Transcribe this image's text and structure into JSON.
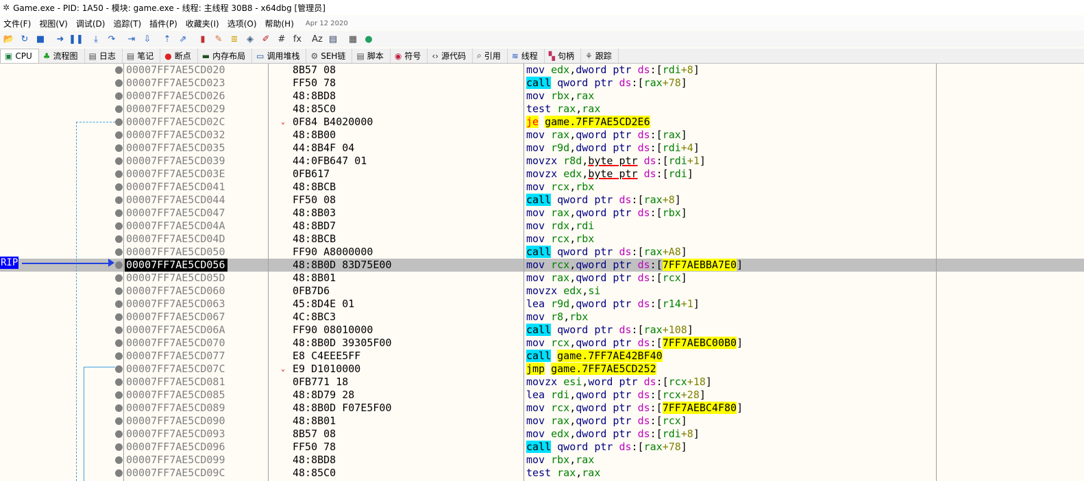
{
  "window": {
    "title": "Game.exe - PID: 1A50 - 模块: game.exe - 线程: 主线程 30B8 - x64dbg [管理员]"
  },
  "menu": [
    "文件(F)",
    "视图(V)",
    "调试(D)",
    "追踪(T)",
    "插件(P)",
    "收藏夹(I)",
    "选项(O)",
    "帮助(H)"
  ],
  "build_date": "Apr 12 2020",
  "toolbar_icons": [
    {
      "name": "open-icon",
      "glyph": "📂",
      "color": "#d8a030"
    },
    {
      "name": "restart-icon",
      "glyph": "↻",
      "color": "#2060c0"
    },
    {
      "name": "stop-icon",
      "glyph": "■",
      "color": "#2060c0"
    },
    {
      "name": "sep"
    },
    {
      "name": "run-icon",
      "glyph": "➜",
      "color": "#2060c0"
    },
    {
      "name": "pause-icon",
      "glyph": "❚❚",
      "color": "#2060c0"
    },
    {
      "name": "sep"
    },
    {
      "name": "step-into-icon",
      "glyph": "⤓",
      "color": "#2060c0"
    },
    {
      "name": "step-over-icon",
      "glyph": "↷",
      "color": "#2060c0"
    },
    {
      "name": "sep"
    },
    {
      "name": "trace-into-icon",
      "glyph": "⇥",
      "color": "#2060c0"
    },
    {
      "name": "trace-over-icon",
      "glyph": "⇩",
      "color": "#2060c0"
    },
    {
      "name": "sep"
    },
    {
      "name": "execute-till-return-icon",
      "glyph": "⇡",
      "color": "#2060c0"
    },
    {
      "name": "run-to-user-code-icon",
      "glyph": "⇗",
      "color": "#2060c0"
    },
    {
      "name": "sep"
    },
    {
      "name": "scylla-icon",
      "glyph": "▮",
      "color": "#c03030"
    },
    {
      "name": "patch-icon",
      "glyph": "✎",
      "color": "#d07030"
    },
    {
      "name": "comment-icon",
      "glyph": "≣",
      "color": "#d0a000"
    },
    {
      "name": "label-icon",
      "glyph": "◈",
      "color": "#406080"
    },
    {
      "name": "highlight-icon",
      "glyph": "✐",
      "color": "#c02020"
    },
    {
      "name": "hash-icon",
      "glyph": "#",
      "color": "#303030"
    },
    {
      "name": "function-icon",
      "glyph": "fx",
      "color": "#303030"
    },
    {
      "name": "sep"
    },
    {
      "name": "font-icon",
      "glyph": "Aᴢ",
      "color": "#303030"
    },
    {
      "name": "document-icon",
      "glyph": "▤",
      "color": "#304060"
    },
    {
      "name": "sep"
    },
    {
      "name": "calculator-icon",
      "glyph": "▦",
      "color": "#404040"
    },
    {
      "name": "globe-icon",
      "glyph": "●",
      "color": "#20a060"
    }
  ],
  "tabs": [
    {
      "label": "CPU",
      "icon": "cpu-icon",
      "glyph": "▣",
      "color": "#208040"
    },
    {
      "label": "流程图",
      "icon": "graph-icon",
      "glyph": "♣",
      "color": "#20a020"
    },
    {
      "label": "日志",
      "icon": "log-icon",
      "glyph": "▤",
      "color": "#505050"
    },
    {
      "label": "笔记",
      "icon": "notes-icon",
      "glyph": "▤",
      "color": "#505050"
    },
    {
      "label": "断点",
      "icon": "breakpoint-icon",
      "glyph": "●",
      "color": "#e02020"
    },
    {
      "label": "内存布局",
      "icon": "memory-map-icon",
      "glyph": "▬",
      "color": "#205020"
    },
    {
      "label": "调用堆栈",
      "icon": "call-stack-icon",
      "glyph": "▭",
      "color": "#2050a0"
    },
    {
      "label": "SEH链",
      "icon": "seh-icon",
      "glyph": "⚙",
      "color": "#505050"
    },
    {
      "label": "脚本",
      "icon": "script-icon",
      "glyph": "▤",
      "color": "#505050"
    },
    {
      "label": "符号",
      "icon": "symbols-icon",
      "glyph": "◉",
      "color": "#c02040"
    },
    {
      "label": "源代码",
      "icon": "source-icon",
      "glyph": "‹›",
      "color": "#303030"
    },
    {
      "label": "引用",
      "icon": "references-icon",
      "glyph": "⌕",
      "color": "#303030"
    },
    {
      "label": "线程",
      "icon": "threads-icon",
      "glyph": "≋",
      "color": "#2050c0"
    },
    {
      "label": "句柄",
      "icon": "handles-icon",
      "glyph": "▚",
      "color": "#c03060"
    },
    {
      "label": "跟踪",
      "icon": "trace-icon",
      "glyph": "⚘",
      "color": "#505050"
    }
  ],
  "rip_label": "RIP",
  "rows": [
    {
      "addr": "00007FF7AE5CD020",
      "bytes": "8B57 08",
      "tokens": [
        [
          "mn",
          "mov "
        ],
        [
          "reg",
          "edx"
        ],
        [
          "pl",
          ","
        ],
        [
          "kw",
          "dword ptr "
        ],
        [
          "seg",
          "ds"
        ],
        [
          "pl",
          ":["
        ],
        [
          "reg",
          "rdi"
        ],
        [
          "num",
          "+8"
        ],
        [
          "pl",
          "]"
        ]
      ]
    },
    {
      "addr": "00007FF7AE5CD023",
      "bytes": "FF50 78",
      "tokens": [
        [
          "call",
          "call"
        ],
        [
          "pl",
          " "
        ],
        [
          "kw",
          "qword ptr "
        ],
        [
          "seg",
          "ds"
        ],
        [
          "pl",
          ":["
        ],
        [
          "reg",
          "rax"
        ],
        [
          "num",
          "+78"
        ],
        [
          "pl",
          "]"
        ]
      ]
    },
    {
      "addr": "00007FF7AE5CD026",
      "bytes": "48:8BD8",
      "tokens": [
        [
          "mn",
          "mov "
        ],
        [
          "reg",
          "rbx"
        ],
        [
          "pl",
          ","
        ],
        [
          "reg",
          "rax"
        ]
      ]
    },
    {
      "addr": "00007FF7AE5CD029",
      "bytes": "48:85C0",
      "tokens": [
        [
          "mn",
          "test "
        ],
        [
          "reg",
          "rax"
        ],
        [
          "pl",
          ","
        ],
        [
          "reg",
          "rax"
        ]
      ]
    },
    {
      "addr": "00007FF7AE5CD02C",
      "bytes": "0F84 B4020000",
      "jump": "⌄",
      "tokens": [
        [
          "jcc",
          "je"
        ],
        [
          "pl",
          " "
        ],
        [
          "jmp",
          "game.7FF7AE5CD2E6"
        ]
      ]
    },
    {
      "addr": "00007FF7AE5CD032",
      "bytes": "48:8B00",
      "tokens": [
        [
          "mn",
          "mov "
        ],
        [
          "reg",
          "rax"
        ],
        [
          "pl",
          ","
        ],
        [
          "kw",
          "qword ptr "
        ],
        [
          "seg",
          "ds"
        ],
        [
          "pl",
          ":["
        ],
        [
          "reg",
          "rax"
        ],
        [
          "pl",
          "]"
        ]
      ]
    },
    {
      "addr": "00007FF7AE5CD035",
      "bytes": "44:8B4F 04",
      "tokens": [
        [
          "mn",
          "mov "
        ],
        [
          "reg",
          "r9d"
        ],
        [
          "pl",
          ","
        ],
        [
          "kw",
          "dword ptr "
        ],
        [
          "seg",
          "ds"
        ],
        [
          "pl",
          ":["
        ],
        [
          "reg",
          "rdi"
        ],
        [
          "num",
          "+4"
        ],
        [
          "pl",
          "]"
        ]
      ]
    },
    {
      "addr": "00007FF7AE5CD039",
      "bytes": "44:0FB647 01",
      "tokens": [
        [
          "mn",
          "movzx "
        ],
        [
          "reg",
          "r8d"
        ],
        [
          "pl",
          ","
        ],
        [
          "ul",
          "byte ptr"
        ],
        [
          "pl",
          " "
        ],
        [
          "seg",
          "ds"
        ],
        [
          "pl",
          ":["
        ],
        [
          "reg",
          "rdi"
        ],
        [
          "num",
          "+1"
        ],
        [
          "pl",
          "]"
        ]
      ]
    },
    {
      "addr": "00007FF7AE5CD03E",
      "bytes": "0FB617",
      "tokens": [
        [
          "mn",
          "movzx "
        ],
        [
          "reg",
          "edx"
        ],
        [
          "pl",
          ","
        ],
        [
          "ul",
          "byte ptr"
        ],
        [
          "pl",
          " "
        ],
        [
          "seg",
          "ds"
        ],
        [
          "pl",
          ":["
        ],
        [
          "reg",
          "rdi"
        ],
        [
          "pl",
          "]"
        ]
      ]
    },
    {
      "addr": "00007FF7AE5CD041",
      "bytes": "48:8BCB",
      "tokens": [
        [
          "mn",
          "mov "
        ],
        [
          "reg",
          "rcx"
        ],
        [
          "pl",
          ","
        ],
        [
          "reg",
          "rbx"
        ]
      ]
    },
    {
      "addr": "00007FF7AE5CD044",
      "bytes": "FF50 08",
      "tokens": [
        [
          "call",
          "call"
        ],
        [
          "pl",
          " "
        ],
        [
          "kw",
          "qword ptr "
        ],
        [
          "seg",
          "ds"
        ],
        [
          "pl",
          ":["
        ],
        [
          "reg",
          "rax"
        ],
        [
          "num",
          "+8"
        ],
        [
          "pl",
          "]"
        ]
      ]
    },
    {
      "addr": "00007FF7AE5CD047",
      "bytes": "48:8B03",
      "tokens": [
        [
          "mn",
          "mov "
        ],
        [
          "reg",
          "rax"
        ],
        [
          "pl",
          ","
        ],
        [
          "kw",
          "qword ptr "
        ],
        [
          "seg",
          "ds"
        ],
        [
          "pl",
          ":["
        ],
        [
          "reg",
          "rbx"
        ],
        [
          "pl",
          "]"
        ]
      ]
    },
    {
      "addr": "00007FF7AE5CD04A",
      "bytes": "48:8BD7",
      "tokens": [
        [
          "mn",
          "mov "
        ],
        [
          "reg",
          "rdx"
        ],
        [
          "pl",
          ","
        ],
        [
          "reg",
          "rdi"
        ]
      ]
    },
    {
      "addr": "00007FF7AE5CD04D",
      "bytes": "48:8BCB",
      "tokens": [
        [
          "mn",
          "mov "
        ],
        [
          "reg",
          "rcx"
        ],
        [
          "pl",
          ","
        ],
        [
          "reg",
          "rbx"
        ]
      ]
    },
    {
      "addr": "00007FF7AE5CD050",
      "bytes": "FF90 A8000000",
      "tokens": [
        [
          "call",
          "call"
        ],
        [
          "pl",
          " "
        ],
        [
          "kw",
          "qword ptr "
        ],
        [
          "seg",
          "ds"
        ],
        [
          "pl",
          ":["
        ],
        [
          "reg",
          "rax"
        ],
        [
          "num",
          "+A8"
        ],
        [
          "pl",
          "]"
        ]
      ]
    },
    {
      "addr": "00007FF7AE5CD056",
      "bytes": "48:8B0D 83D75E00",
      "current": true,
      "tokens": [
        [
          "mn",
          "mov "
        ],
        [
          "reg",
          "rcx"
        ],
        [
          "pl",
          ","
        ],
        [
          "kw",
          "qword ptr "
        ],
        [
          "seg",
          "ds"
        ],
        [
          "pl",
          ":["
        ],
        [
          "addrref",
          "7FF7AEBBA7E0"
        ],
        [
          "pl",
          "]"
        ]
      ]
    },
    {
      "addr": "00007FF7AE5CD05D",
      "bytes": "48:8B01",
      "tokens": [
        [
          "mn",
          "mov "
        ],
        [
          "reg",
          "rax"
        ],
        [
          "pl",
          ","
        ],
        [
          "kw",
          "qword ptr "
        ],
        [
          "seg",
          "ds"
        ],
        [
          "pl",
          ":["
        ],
        [
          "reg",
          "rcx"
        ],
        [
          "pl",
          "]"
        ]
      ]
    },
    {
      "addr": "00007FF7AE5CD060",
      "bytes": "0FB7D6",
      "tokens": [
        [
          "mn",
          "movzx "
        ],
        [
          "reg",
          "edx"
        ],
        [
          "pl",
          ","
        ],
        [
          "reg",
          "si"
        ]
      ]
    },
    {
      "addr": "00007FF7AE5CD063",
      "bytes": "45:8D4E 01",
      "tokens": [
        [
          "mn",
          "lea "
        ],
        [
          "reg",
          "r9d"
        ],
        [
          "pl",
          ","
        ],
        [
          "kw",
          "qword ptr "
        ],
        [
          "seg",
          "ds"
        ],
        [
          "pl",
          ":["
        ],
        [
          "reg",
          "r14"
        ],
        [
          "num",
          "+1"
        ],
        [
          "pl",
          "]"
        ]
      ]
    },
    {
      "addr": "00007FF7AE5CD067",
      "bytes": "4C:8BC3",
      "tokens": [
        [
          "mn",
          "mov "
        ],
        [
          "reg",
          "r8"
        ],
        [
          "pl",
          ","
        ],
        [
          "reg",
          "rbx"
        ]
      ]
    },
    {
      "addr": "00007FF7AE5CD06A",
      "bytes": "FF90 08010000",
      "tokens": [
        [
          "call",
          "call"
        ],
        [
          "pl",
          " "
        ],
        [
          "kw",
          "qword ptr "
        ],
        [
          "seg",
          "ds"
        ],
        [
          "pl",
          ":["
        ],
        [
          "reg",
          "rax"
        ],
        [
          "num",
          "+108"
        ],
        [
          "pl",
          "]"
        ]
      ]
    },
    {
      "addr": "00007FF7AE5CD070",
      "bytes": "48:8B0D 39305F00",
      "tokens": [
        [
          "mn",
          "mov "
        ],
        [
          "reg",
          "rcx"
        ],
        [
          "pl",
          ","
        ],
        [
          "kw",
          "qword ptr "
        ],
        [
          "seg",
          "ds"
        ],
        [
          "pl",
          ":["
        ],
        [
          "addrref",
          "7FF7AEBC00B0"
        ],
        [
          "pl",
          "]"
        ]
      ]
    },
    {
      "addr": "00007FF7AE5CD077",
      "bytes": "E8 C4EEE5FF",
      "tokens": [
        [
          "call",
          "call"
        ],
        [
          "pl",
          " "
        ],
        [
          "jmp",
          "game.7FF7AE42BF40"
        ]
      ]
    },
    {
      "addr": "00007FF7AE5CD07C",
      "bytes": "E9 D1010000",
      "jump": "⌄",
      "tokens": [
        [
          "jmp",
          "jmp"
        ],
        [
          "pl",
          " "
        ],
        [
          "jmp",
          "game.7FF7AE5CD252"
        ]
      ]
    },
    {
      "addr": "00007FF7AE5CD081",
      "bytes": "0FB771 18",
      "tokens": [
        [
          "mn",
          "movzx "
        ],
        [
          "reg",
          "esi"
        ],
        [
          "pl",
          ","
        ],
        [
          "kw",
          "word ptr "
        ],
        [
          "seg",
          "ds"
        ],
        [
          "pl",
          ":["
        ],
        [
          "reg",
          "rcx"
        ],
        [
          "num",
          "+18"
        ],
        [
          "pl",
          "]"
        ]
      ]
    },
    {
      "addr": "00007FF7AE5CD085",
      "bytes": "48:8D79 28",
      "tokens": [
        [
          "mn",
          "lea "
        ],
        [
          "reg",
          "rdi"
        ],
        [
          "pl",
          ","
        ],
        [
          "kw",
          "qword ptr "
        ],
        [
          "seg",
          "ds"
        ],
        [
          "pl",
          ":["
        ],
        [
          "reg",
          "rcx"
        ],
        [
          "num",
          "+28"
        ],
        [
          "pl",
          "]"
        ]
      ]
    },
    {
      "addr": "00007FF7AE5CD089",
      "bytes": "48:8B0D F07E5F00",
      "tokens": [
        [
          "mn",
          "mov "
        ],
        [
          "reg",
          "rcx"
        ],
        [
          "pl",
          ","
        ],
        [
          "kw",
          "qword ptr "
        ],
        [
          "seg",
          "ds"
        ],
        [
          "pl",
          ":["
        ],
        [
          "addrref",
          "7FF7AEBC4F80"
        ],
        [
          "pl",
          "]"
        ]
      ]
    },
    {
      "addr": "00007FF7AE5CD090",
      "bytes": "48:8B01",
      "tokens": [
        [
          "mn",
          "mov "
        ],
        [
          "reg",
          "rax"
        ],
        [
          "pl",
          ","
        ],
        [
          "kw",
          "qword ptr "
        ],
        [
          "seg",
          "ds"
        ],
        [
          "pl",
          ":["
        ],
        [
          "reg",
          "rcx"
        ],
        [
          "pl",
          "]"
        ]
      ]
    },
    {
      "addr": "00007FF7AE5CD093",
      "bytes": "8B57 08",
      "tokens": [
        [
          "mn",
          "mov "
        ],
        [
          "reg",
          "edx"
        ],
        [
          "pl",
          ","
        ],
        [
          "kw",
          "dword ptr "
        ],
        [
          "seg",
          "ds"
        ],
        [
          "pl",
          ":["
        ],
        [
          "reg",
          "rdi"
        ],
        [
          "num",
          "+8"
        ],
        [
          "pl",
          "]"
        ]
      ]
    },
    {
      "addr": "00007FF7AE5CD096",
      "bytes": "FF50 78",
      "tokens": [
        [
          "call",
          "call"
        ],
        [
          "pl",
          " "
        ],
        [
          "kw",
          "qword ptr "
        ],
        [
          "seg",
          "ds"
        ],
        [
          "pl",
          ":["
        ],
        [
          "reg",
          "rax"
        ],
        [
          "num",
          "+78"
        ],
        [
          "pl",
          "]"
        ]
      ]
    },
    {
      "addr": "00007FF7AE5CD099",
      "bytes": "48:8BD8",
      "tokens": [
        [
          "mn",
          "mov "
        ],
        [
          "reg",
          "rbx"
        ],
        [
          "pl",
          ","
        ],
        [
          "reg",
          "rax"
        ]
      ]
    },
    {
      "addr": "00007FF7AE5CD09C",
      "bytes": "48:85C0",
      "tokens": [
        [
          "mn",
          "test "
        ],
        [
          "reg",
          "rax"
        ],
        [
          "pl",
          ","
        ],
        [
          "reg",
          "rax"
        ]
      ]
    }
  ]
}
